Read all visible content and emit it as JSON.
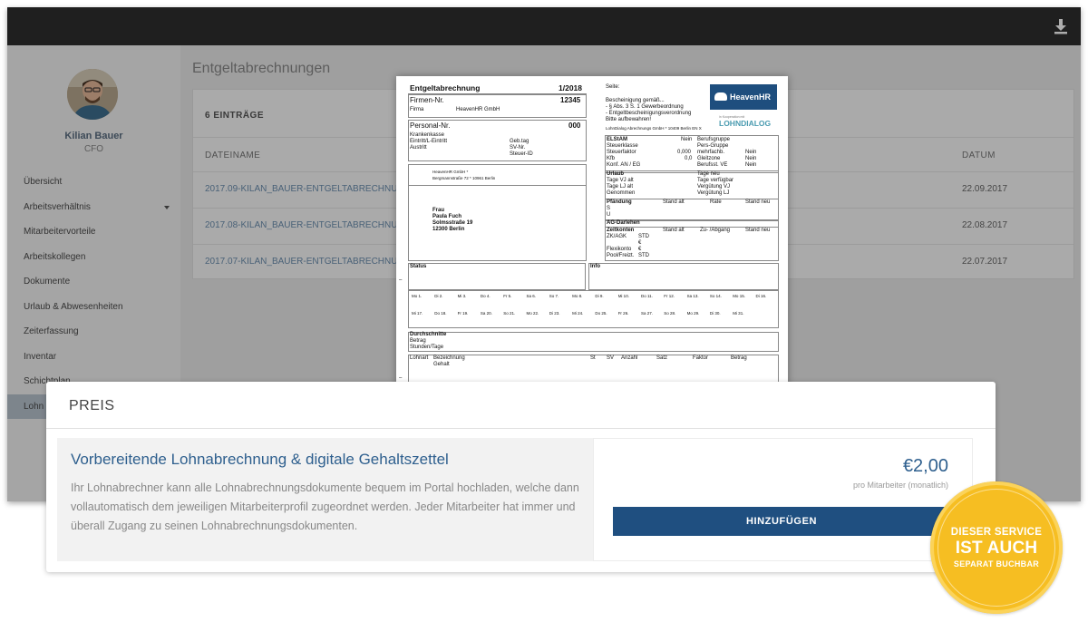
{
  "sidebar": {
    "user_name": "Kilian Bauer",
    "user_role": "CFO",
    "items": [
      {
        "label": "Übersicht"
      },
      {
        "label": "Arbeitsverhältnis"
      },
      {
        "label": "Mitarbeitervorteile"
      },
      {
        "label": "Arbeitskollegen"
      },
      {
        "label": "Dokumente"
      },
      {
        "label": "Urlaub & Abwesenheiten"
      },
      {
        "label": "Zeiterfassung"
      },
      {
        "label": "Inventar"
      },
      {
        "label": "Schichtplan"
      },
      {
        "label": "Lohn"
      }
    ]
  },
  "main": {
    "title": "Entgeltabrechnungen",
    "entries": "6 EINTRÄGE",
    "col_file": "DATEINAME",
    "col_date": "DATUM",
    "rows": [
      {
        "file": "2017.09-KILAN_BAUER-ENTGELTABRECHNUNG.P",
        "date": "22.09.2017"
      },
      {
        "file": "2017.08-KILAN_BAUER-ENTGELTABRECHNUNG.P",
        "date": "22.08.2017"
      },
      {
        "file": "2017.07-KILAN_BAUER-ENTGELTABRECHNUNG.P",
        "date": "22.07.2017"
      }
    ]
  },
  "payslip": {
    "title": "Entgeltabrechnung",
    "period": "1/2018",
    "firmen_label": "Firmen-Nr.",
    "firmen_nr": "12345",
    "firma_label": "Firma",
    "firma": "HeavenHR GmbH",
    "personal_label": "Personal-Nr.",
    "personal_nr": "000",
    "kk": "Krankenkasse",
    "eintritt": "Eintritt/L-Eintritt",
    "austritt": "Austritt",
    "gebtag": "Geb.tag",
    "svnr": "SV-Nr.",
    "steuerid": "Steuer-ID",
    "sender": "HeavenHR GmbH *",
    "sender_addr": "Bergmannstraße 72 * 10961 Berlin",
    "recipient": [
      "Frau",
      "Paula Fuch",
      "Solmsstraße 19",
      "12300 Berlin"
    ],
    "seite": "Seite:",
    "bescheinigung": [
      "Bescheinigung gemäß...",
      "- §      Abs. 3 S. 1 Gewerbeordnung",
      "- Entgeltbescheinigungsverordnung",
      "Bitte aufbewahren!"
    ],
    "lohndialog_addr": "LohnDialog Abrechnungs GmbH * 10409 Berlin    EN X",
    "logo": "HeavenHR",
    "partner_small": "in Kooperation mit",
    "partner": "LOHNDIALOG",
    "elstam": "ELStAM",
    "nein": "Nein",
    "steuerklasse": "Steuerklasse",
    "steuerfaktor": "Steuerfaktor",
    "steuerfaktor_val": "0,000",
    "kfb": "Kfb",
    "kfb_val": "0,0",
    "konf": "Konf. AN / EG",
    "berufsgruppe": "Berufsgruppe",
    "persgruppe": "Pers-Gruppe",
    "mehrfach": "mehrfachb.",
    "gleitzone": "Gleitzone",
    "berufsst": "Berufsst. VE",
    "urlaub": "Urlaub",
    "tage_vj": "Tage VJ alt",
    "tage_lj": "Tage LJ alt",
    "genommen": "Genommen",
    "tage_neu": "Tage neu",
    "tage_verf": "Tage verfügbar",
    "verg_vj": "Vergütung VJ",
    "verg_lj": "Vergütung LJ",
    "pfaendung": "Pfändung",
    "stand_alt": "Stand alt",
    "rate": "Rate",
    "stand_neu": "Stand neu",
    "s": "S",
    "u": "U",
    "ag_darlehen": "AG-Darlehen",
    "zeitkonten": "Zeitkonten",
    "zu_abgang": "Zu- /Abgang",
    "zkagk": "ZK/AGK",
    "std": "STD",
    "euro": "€",
    "flexikonto": "Flexikonto",
    "pool": "Pool/Freizt.",
    "status": "Status",
    "info": "Info",
    "days1": [
      "Mo 1.",
      "Di 2.",
      "Mi 3.",
      "Do 4.",
      "Fr 5.",
      "Sa 6.",
      "So 7.",
      "Mo 8.",
      "Di 9.",
      "Mi 10.",
      "Do 11.",
      "Fr 12.",
      "Sa 13.",
      "So 14.",
      "Mo 15.",
      "Di 16."
    ],
    "days2": [
      "Mi 17.",
      "Do 18.",
      "Fr 19.",
      "Sa 20.",
      "So 21.",
      "Mo 22.",
      "Di 23.",
      "Mi 24.",
      "Do 25.",
      "Fr 26.",
      "Sa 27.",
      "So 28.",
      "Mo 29.",
      "Di 30.",
      "Mi 31."
    ],
    "durchschnitte": "Durchschnitte",
    "betrag": "Betrag",
    "stunden": "Stunden/Tage",
    "lohnart": "Lohnart",
    "bezeichnung": "Bezeichnung",
    "gehalt": "Gehalt",
    "st": "St",
    "sv": "SV",
    "anzahl": "Anzahl",
    "satz": "Satz",
    "faktor": "Faktor",
    "betrag2": "Betrag",
    "dash": "–"
  },
  "panel": {
    "title": "PREIS",
    "offer_title": "Vorbereitende Lohnabrechnung & digitale Gehaltszettel",
    "offer_desc": "Ihr Lohnabrechner kann alle Lohnabrechnungsdokumente bequem im Portal hochladen, welche dann vollautomatisch dem jeweiligen Mitarbeiterprofil zugeordnet werden. Jeder Mitarbeiter hat immer und überall Zugang zu seinen Lohnabrechnungsdokumenten.",
    "price": "€2,00",
    "price_note": "pro Mitarbeiter (monatlich)",
    "button": "HINZUFÜGEN"
  },
  "badge": {
    "line1": "DIESER SERVICE",
    "line2": "IST AUCH",
    "line3": "SEPARAT BUCHBAR"
  },
  "colors": {
    "accent": "#1f4f80",
    "badge": "#f6be22"
  }
}
